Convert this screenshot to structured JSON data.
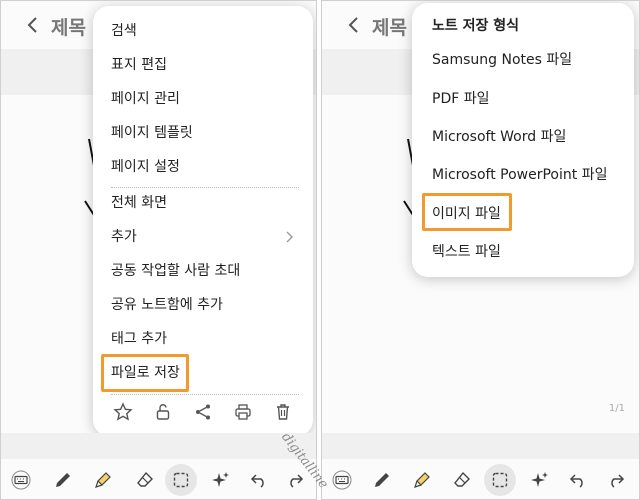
{
  "left_panel": {
    "title": "제목",
    "menu": {
      "items": [
        {
          "label": "검색"
        },
        {
          "label": "표지 편집"
        },
        {
          "label": "페이지 관리"
        },
        {
          "label": "페이지 템플릿"
        },
        {
          "label": "페이지 설정"
        },
        {
          "label": "전체 화면"
        },
        {
          "label": "추가"
        },
        {
          "label": "공동 작업할 사람 초대"
        },
        {
          "label": "공유 노트함에 추가"
        },
        {
          "label": "태그 추가"
        },
        {
          "label": "파일로 저장"
        }
      ],
      "highlighted": "파일로 저장",
      "icons": [
        "star-icon",
        "unlock-icon",
        "share-icon",
        "print-icon",
        "trash-icon"
      ]
    }
  },
  "right_panel": {
    "title": "제목",
    "page_counter": "1/1",
    "format_menu": {
      "title": "노트 저장 형식",
      "items": [
        {
          "label": "Samsung Notes 파일"
        },
        {
          "label": "PDF 파일"
        },
        {
          "label": "Microsoft Word 파일"
        },
        {
          "label": "Microsoft PowerPoint 파일"
        },
        {
          "label": "이미지 파일"
        },
        {
          "label": "텍스트 파일"
        }
      ],
      "highlighted": "이미지 파일"
    }
  },
  "toolbar": {
    "tools": [
      "keyboard-icon",
      "pen-icon",
      "highlighter-icon",
      "eraser-icon",
      "selection-icon",
      "ai-sparkle-icon",
      "undo-icon",
      "redo-icon"
    ],
    "selected": "selection-icon"
  },
  "watermark": "digitalline",
  "colors": {
    "highlight": "#f39a2e",
    "background": "#fbfbfb",
    "band": "#f0f0f0"
  }
}
